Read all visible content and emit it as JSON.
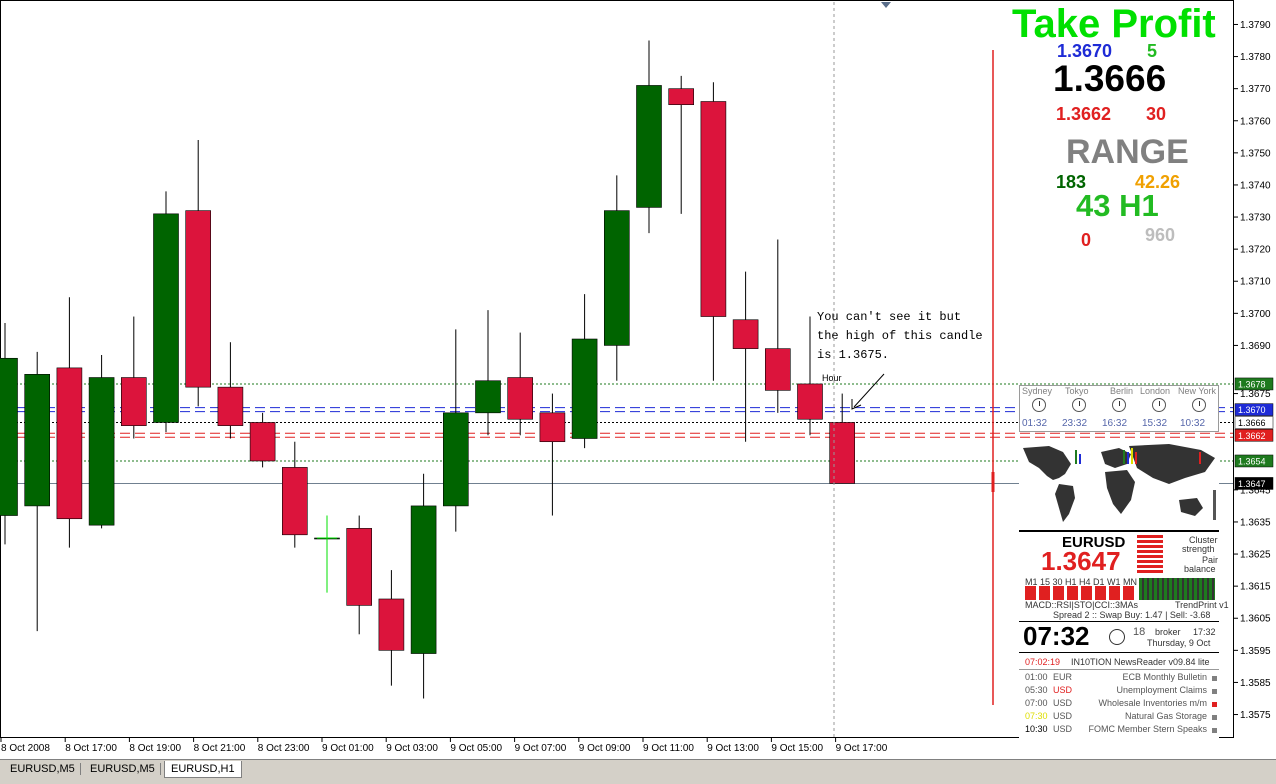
{
  "colors": {
    "bull": "#006400",
    "bear": "#dc143c",
    "blue_lines": "#1e2bd6",
    "red_lines": "#e02020",
    "green_dotted": "#1e7a1e",
    "price_line": "#708090",
    "take_profit": "#00e000"
  },
  "chart_data": {
    "type": "candlestick",
    "title": "",
    "symbol": "EURUSD,H1",
    "ylim": [
      1.3568,
      1.3797
    ],
    "y_ticks": [
      "1.3790",
      "1.3780",
      "1.3770",
      "1.3760",
      "1.3750",
      "1.3740",
      "1.3730",
      "1.3720",
      "1.3710",
      "1.3700",
      "1.3690",
      "1.3675",
      "1.3670",
      "1.3666",
      "1.3662",
      "1.3654",
      "1.3647",
      "1.3645",
      "1.3635",
      "1.3625",
      "1.3615",
      "1.3605",
      "1.3595",
      "1.3585",
      "1.3575"
    ],
    "x_ticks": [
      "8 Oct 2008",
      "8 Oct 17:00",
      "8 Oct 19:00",
      "8 Oct 21:00",
      "8 Oct 23:00",
      "9 Oct 01:00",
      "9 Oct 03:00",
      "9 Oct 05:00",
      "9 Oct 07:00",
      "9 Oct 09:00",
      "9 Oct 11:00",
      "9 Oct 13:00",
      "9 Oct 15:00",
      "9 Oct 17:00"
    ],
    "candles": [
      {
        "o": 1.3637,
        "h": 1.3697,
        "l": 1.3628,
        "c": 1.3686
      },
      {
        "o": 1.364,
        "h": 1.3688,
        "l": 1.3601,
        "c": 1.3681
      },
      {
        "o": 1.3683,
        "h": 1.3705,
        "l": 1.3627,
        "c": 1.3636
      },
      {
        "o": 1.3634,
        "h": 1.3687,
        "l": 1.3633,
        "c": 1.368
      },
      {
        "o": 1.368,
        "h": 1.3699,
        "l": 1.3661,
        "c": 1.3665
      },
      {
        "o": 1.3666,
        "h": 1.3738,
        "l": 1.3663,
        "c": 1.3731
      },
      {
        "o": 1.3732,
        "h": 1.3754,
        "l": 1.3671,
        "c": 1.3677
      },
      {
        "o": 1.3677,
        "h": 1.3691,
        "l": 1.3661,
        "c": 1.3665
      },
      {
        "o": 1.3666,
        "h": 1.3669,
        "l": 1.3652,
        "c": 1.3654
      },
      {
        "o": 1.3652,
        "h": 1.366,
        "l": 1.3627,
        "c": 1.3631
      },
      {
        "o": 1.363,
        "h": 1.3632,
        "l": 1.3617,
        "c": 1.363
      },
      {
        "o": 1.3633,
        "h": 1.3637,
        "l": 1.36,
        "c": 1.3609
      },
      {
        "o": 1.3611,
        "h": 1.362,
        "l": 1.3584,
        "c": 1.3595
      },
      {
        "o": 1.3594,
        "h": 1.365,
        "l": 1.358,
        "c": 1.364
      },
      {
        "o": 1.364,
        "h": 1.3695,
        "l": 1.3632,
        "c": 1.3669
      },
      {
        "o": 1.3669,
        "h": 1.3701,
        "l": 1.3662,
        "c": 1.3679
      },
      {
        "o": 1.368,
        "h": 1.3694,
        "l": 1.3662,
        "c": 1.3667
      },
      {
        "o": 1.3669,
        "h": 1.3675,
        "l": 1.3637,
        "c": 1.366
      },
      {
        "o": 1.3661,
        "h": 1.3706,
        "l": 1.3658,
        "c": 1.3692
      },
      {
        "o": 1.369,
        "h": 1.3743,
        "l": 1.3679,
        "c": 1.3732
      },
      {
        "o": 1.3733,
        "h": 1.3785,
        "l": 1.3725,
        "c": 1.3771
      },
      {
        "o": 1.377,
        "h": 1.3774,
        "l": 1.3731,
        "c": 1.3765
      },
      {
        "o": 1.3766,
        "h": 1.3772,
        "l": 1.3679,
        "c": 1.3699
      },
      {
        "o": 1.3698,
        "h": 1.3713,
        "l": 1.366,
        "c": 1.3689
      },
      {
        "o": 1.3689,
        "h": 1.3723,
        "l": 1.3669,
        "c": 1.3676
      },
      {
        "o": 1.3678,
        "h": 1.3699,
        "l": 1.3662,
        "c": 1.3667
      },
      {
        "o": 1.3666,
        "h": 1.3675,
        "l": 1.3647,
        "c": 1.3647
      }
    ],
    "levels": [
      {
        "label": "1.3678",
        "value": 1.3678,
        "kind": "green_dotted"
      },
      {
        "label": "1.3670",
        "value": 1.367,
        "kind": "blue"
      },
      {
        "label": "1.3666",
        "value": 1.3666,
        "kind": "black"
      },
      {
        "label": "1.3662",
        "value": 1.3662,
        "kind": "red"
      },
      {
        "label": "1.3654",
        "value": 1.3654,
        "kind": "green_dotted"
      },
      {
        "label": "1.3647",
        "value": 1.3647,
        "kind": "current"
      }
    ],
    "annotation": {
      "text_lines": [
        "You can't see it but",
        "the high of this candle",
        "is 1.3675."
      ],
      "hour_label": "Hour"
    }
  },
  "overlay": {
    "take_profit": "Take Profit",
    "tp_blue_price": "1.3670",
    "tp_blue_pips": "5",
    "main_price": "1.3666",
    "tp_red_price": "1.3662",
    "tp_red_pips": "30",
    "range_title": "RANGE",
    "range_left": "183",
    "range_right": "42.26",
    "range_tf": "43 H1",
    "range_zero": "0",
    "range_960": "960"
  },
  "sessions": {
    "names": [
      "Sydney",
      "Tokyo",
      "Berlin",
      "London",
      "New York"
    ],
    "times": [
      "01:32",
      "23:32",
      "16:32",
      "15:32",
      "10:32"
    ]
  },
  "indicators": {
    "symbol": "EURUSD",
    "price": "1.3647",
    "cluster": "Cluster",
    "strength": "strength",
    "pair": "Pair",
    "balance": "balance",
    "tf_row": "M1 15 30 H1 H4 D1 W1 MN",
    "ind_row": "MACD::RSI|STO|CCI::3MAs",
    "trend": "TrendPrint v1",
    "spread": "Spread 2 :: Swap Buy: 1.47 | Sell: -3.68",
    "clock": "07:32",
    "seconds": "18",
    "broker": "broker",
    "broker_time": "17:32",
    "date": "Thursday, 9 Oct",
    "news_time": "07:02:19",
    "news_title": "IN10TION NewsReader v09.84 lite",
    "news": [
      {
        "time": "01:00",
        "cur": "EUR",
        "event": "ECB Monthly Bulletin",
        "time_color": "#555555",
        "cur_color": "#555555",
        "sq": "#808080"
      },
      {
        "time": "05:30",
        "cur": "USD",
        "event": "Unemployment Claims",
        "time_color": "#555555",
        "cur_color": "#e02020",
        "sq": "#808080"
      },
      {
        "time": "07:00",
        "cur": "USD",
        "event": "Wholesale Inventories m/m",
        "time_color": "#555555",
        "cur_color": "#555555",
        "sq": "#e02020"
      },
      {
        "time": "07:30",
        "cur": "USD",
        "event": "Natural Gas Storage",
        "time_color": "#dede00",
        "cur_color": "#555555",
        "sq": "#808080"
      },
      {
        "time": "10:30",
        "cur": "USD",
        "event": "FOMC Member Stern Speaks",
        "time_color": "#000000",
        "cur_color": "#555555",
        "sq": "#808080"
      }
    ]
  },
  "tabs": [
    "EURUSD,M5",
    "EURUSD,M5",
    "EURUSD,H1"
  ]
}
